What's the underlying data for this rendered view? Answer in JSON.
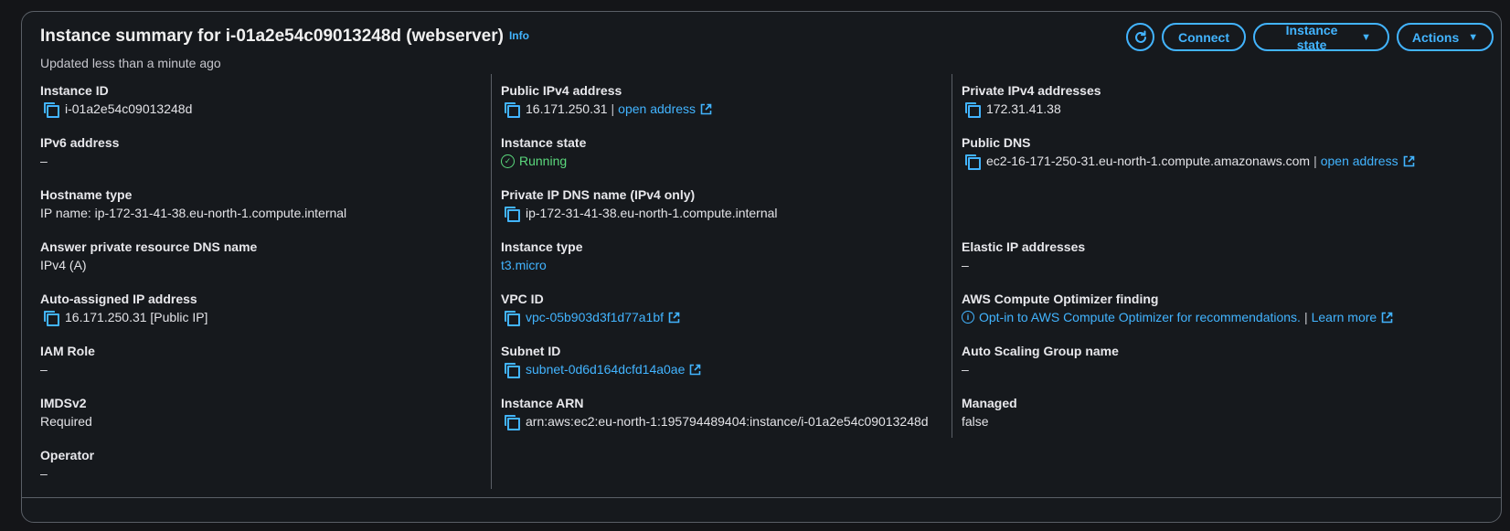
{
  "header": {
    "title": "Instance summary for i-01a2e54c09013248d (webserver)",
    "info": "Info",
    "subtitle": "Updated less than a minute ago"
  },
  "buttons": {
    "refresh_icon": "refresh-icon",
    "connect": "Connect",
    "instance_state": "Instance state",
    "actions": "Actions",
    "caret": "▼"
  },
  "col1": {
    "instance_id": {
      "label": "Instance ID",
      "value": "i-01a2e54c09013248d"
    },
    "ipv6": {
      "label": "IPv6 address",
      "value": "–"
    },
    "hostname_type": {
      "label": "Hostname type",
      "value": "IP name: ip-172-31-41-38.eu-north-1.compute.internal"
    },
    "answer_dns": {
      "label": "Answer private resource DNS name",
      "value": "IPv4 (A)"
    },
    "auto_ip": {
      "label": "Auto-assigned IP address",
      "value": "16.171.250.31 [Public IP]"
    },
    "iam_role": {
      "label": "IAM Role",
      "value": "–"
    },
    "imdsv2": {
      "label": "IMDSv2",
      "value": "Required"
    },
    "operator": {
      "label": "Operator",
      "value": "–"
    }
  },
  "col2": {
    "public_ipv4": {
      "label": "Public IPv4 address",
      "value": "16.171.250.31",
      "sep": "|",
      "link": "open address"
    },
    "instance_state": {
      "label": "Instance state",
      "value": "Running",
      "check": "✓"
    },
    "private_dns": {
      "label": "Private IP DNS name (IPv4 only)",
      "value": "ip-172-31-41-38.eu-north-1.compute.internal"
    },
    "instance_type": {
      "label": "Instance type",
      "value": "t3.micro"
    },
    "vpc_id": {
      "label": "VPC ID",
      "value": "vpc-05b903d3f1d77a1bf"
    },
    "subnet_id": {
      "label": "Subnet ID",
      "value": "subnet-0d6d164dcfd14a0ae"
    },
    "arn": {
      "label": "Instance ARN",
      "value": "arn:aws:ec2:eu-north-1:195794489404:instance/i-01a2e54c09013248d"
    }
  },
  "col3": {
    "private_ipv4": {
      "label": "Private IPv4 addresses",
      "value": "172.31.41.38"
    },
    "public_dns": {
      "label": "Public DNS",
      "value": "ec2-16-171-250-31.eu-north-1.compute.amazonaws.com",
      "sep": "|",
      "link": "open address"
    },
    "elastic_ip": {
      "label": "Elastic IP addresses",
      "value": "–"
    },
    "optimizer": {
      "label": "AWS Compute Optimizer finding",
      "value": "Opt-in to AWS Compute Optimizer for recommendations.",
      "sep": "|",
      "link": "Learn more",
      "info_glyph": "i"
    },
    "asg": {
      "label": "Auto Scaling Group name",
      "value": "–"
    },
    "managed": {
      "label": "Managed",
      "value": "false"
    }
  },
  "colors": {
    "accent": "#42b4ff",
    "success": "#5bd97d",
    "border": "#5a5f66"
  }
}
